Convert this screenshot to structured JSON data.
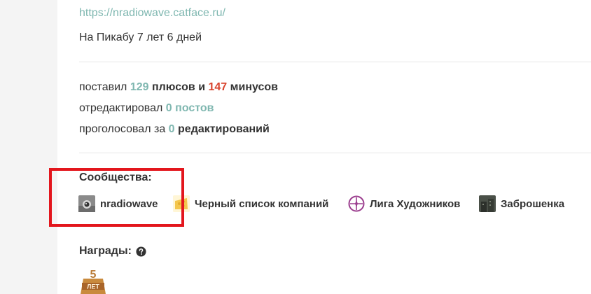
{
  "profile": {
    "url": "https://nradiowave.catface.ru/",
    "age": "На Пикабу 7 лет 6 дней"
  },
  "stats": {
    "line1": {
      "pre": "поставил ",
      "plus_count": "129",
      "mid": " плюсов и ",
      "minus_count": "147",
      "post": " минусов"
    },
    "line2": {
      "pre": "отредактировал ",
      "count": "0",
      "post": " постов"
    },
    "line3": {
      "pre": "проголосовал за ",
      "count": "0",
      "post": " редактирований"
    }
  },
  "communities": {
    "title": "Сообщества:",
    "items": [
      {
        "label": "nradiowave",
        "icon": "camera-avatar-icon"
      },
      {
        "label": "Черный список компаний",
        "icon": "cheese-avatar-icon"
      },
      {
        "label": "Лига Художников",
        "icon": "compass-avatar-icon"
      },
      {
        "label": "Заброшенка",
        "icon": "abandoned-building-avatar-icon"
      }
    ]
  },
  "awards": {
    "title": "Награды:",
    "help_icon": "question-circle-icon",
    "badge_number": "5",
    "badge_text": "ЛЕТ"
  },
  "colors": {
    "accent_green": "#7fb7b0",
    "minus_red": "#d9442e",
    "highlight_red": "#e3161d"
  }
}
